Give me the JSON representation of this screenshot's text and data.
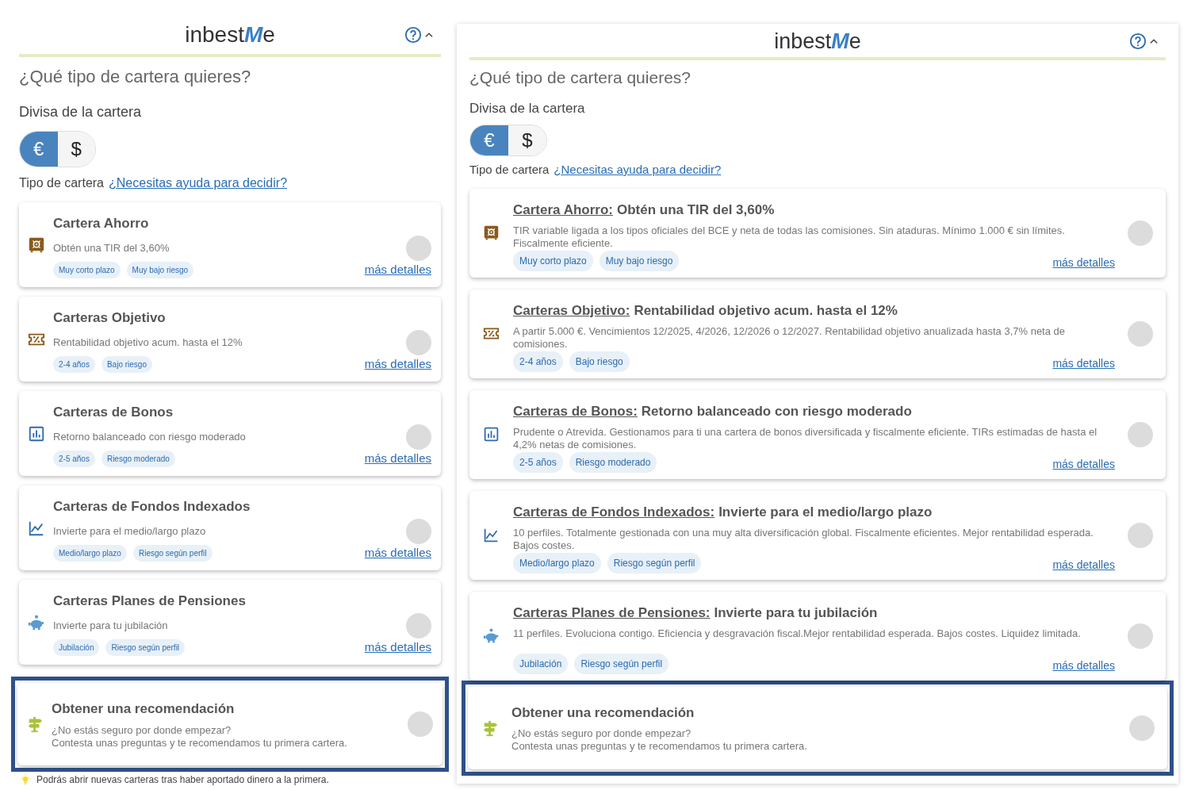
{
  "panels": [
    {
      "kind": "compact",
      "logo": {
        "prefix": "inbest",
        "accent": "M",
        "suffix": "e"
      },
      "title": "¿Qué tipo de cartera quieres?",
      "currency_label": "Divisa de la cartera",
      "currencies": [
        {
          "symbol": "€",
          "selected": true
        },
        {
          "symbol": "$",
          "selected": false
        }
      ],
      "type_label": "Tipo de cartera",
      "help_link": "¿Necesitas ayuda para decidir?",
      "options": [
        {
          "kind": "safe",
          "name": "Cartera Ahorro",
          "description": "Obtén una TIR del 3,60%",
          "tags": [
            "Muy corto plazo",
            "Muy bajo riesgo"
          ],
          "details_link": "más detalles",
          "selected": false
        },
        {
          "kind": "ticket",
          "name": "Carteras Objetivo",
          "description": "Rentabilidad objetivo acum. hasta el 12%",
          "tags": [
            "2-4 años",
            "Bajo riesgo"
          ],
          "details_link": "más detalles",
          "selected": false
        },
        {
          "kind": "bar-chart",
          "name": "Carteras de Bonos",
          "description": "Retorno balanceado con riesgo moderado",
          "tags": [
            "2-5 años",
            "Riesgo moderado"
          ],
          "details_link": "más detalles",
          "selected": false
        },
        {
          "kind": "line-chart",
          "name": "Carteras de Fondos Indexados",
          "description": "Invierte para el medio/largo plazo",
          "tags": [
            "Medio/largo plazo",
            "Riesgo según perfil"
          ],
          "details_link": "más detalles",
          "selected": false
        },
        {
          "kind": "piggy-bank",
          "name": "Carteras Planes de Pensiones",
          "description": "Invierte para tu jubilación",
          "tags": [
            "Jubilación",
            "Riesgo según perfil"
          ],
          "details_link": "más detalles",
          "selected": false
        }
      ],
      "recommendation": {
        "kind": "signpost",
        "name": "Obtener una recomendación",
        "lines": [
          "¿No estás seguro por donde empezar?",
          "Contesta unas preguntas y te recomendamos tu primera cartera."
        ],
        "selected": false,
        "highlighted": true
      },
      "footer_note": "Podrás abrir nuevas carteras tras haber aportado dinero a la primera."
    },
    {
      "kind": "wide",
      "logo": {
        "prefix": "inbest",
        "accent": "M",
        "suffix": "e"
      },
      "title": "¿Qué tipo de cartera quieres?",
      "currency_label": "Divisa de la cartera",
      "currencies": [
        {
          "symbol": "€",
          "selected": true
        },
        {
          "symbol": "$",
          "selected": false
        }
      ],
      "type_label": "Tipo de cartera",
      "help_link": "¿Necesitas ayuda para decidir?",
      "options": [
        {
          "kind": "safe",
          "name": "Cartera Ahorro:",
          "headline": "Obtén una TIR del 3,60%",
          "description": "TIR variable ligada a los tipos oficiales del BCE y neta de todas las comisiones. Sin ataduras. Mínimo 1.000 € sin límites. Fiscalmente eficiente.",
          "tags": [
            "Muy corto plazo",
            "Muy bajo riesgo"
          ],
          "details_link": "más detalles",
          "selected": false
        },
        {
          "kind": "ticket",
          "name": "Carteras Objetivo:",
          "headline": "Rentabilidad objetivo acum. hasta el 12%",
          "description": "A partir 5.000 €. Vencimientos 12/2025, 4/2026, 12/2026 o 12/2027. Rentabilidad objetivo anualizada hasta 3,7% neta de comisiones.",
          "tags": [
            "2-4 años",
            "Bajo riesgo"
          ],
          "details_link": "más detalles",
          "selected": false
        },
        {
          "kind": "bar-chart",
          "name": "Carteras de Bonos:",
          "headline": "Retorno balanceado con riesgo moderado",
          "description": "Prudente o Atrevida. Gestionamos para ti una cartera de bonos diversificada y fiscalmente eficiente. TIRs estimadas de hasta el 4,2% netas de comisiones.",
          "tags": [
            "2-5 años",
            "Riesgo moderado"
          ],
          "details_link": "más detalles",
          "selected": false
        },
        {
          "kind": "line-chart",
          "name": "Carteras de Fondos Indexados:",
          "headline": "Invierte para el medio/largo plazo",
          "description": "10 perfiles. Totalmente gestionada con una muy alta diversificación global. Fiscalmente eficientes. Mejor rentabilidad esperada. Bajos costes.",
          "tags": [
            "Medio/largo plazo",
            "Riesgo según perfil"
          ],
          "details_link": "más detalles",
          "selected": false
        },
        {
          "kind": "piggy-bank",
          "name": "Carteras Planes de Pensiones:",
          "headline": "Invierte para tu jubilación",
          "description": "11 perfiles. Evoluciona contigo. Eficiencia y desgravación fiscal.Mejor rentabilidad esperada. Bajos costes. Liquidez limitada.",
          "tags": [
            "Jubilación",
            "Riesgo según perfil"
          ],
          "details_link": "más detalles",
          "selected": false
        }
      ],
      "recommendation": {
        "kind": "signpost",
        "name": "Obtener una recomendación",
        "lines": [
          "¿No estás seguro por donde empezar?",
          "Contesta unas preguntas y te recomendamos tu primera cartera."
        ],
        "selected": false,
        "highlighted": true
      }
    }
  ]
}
